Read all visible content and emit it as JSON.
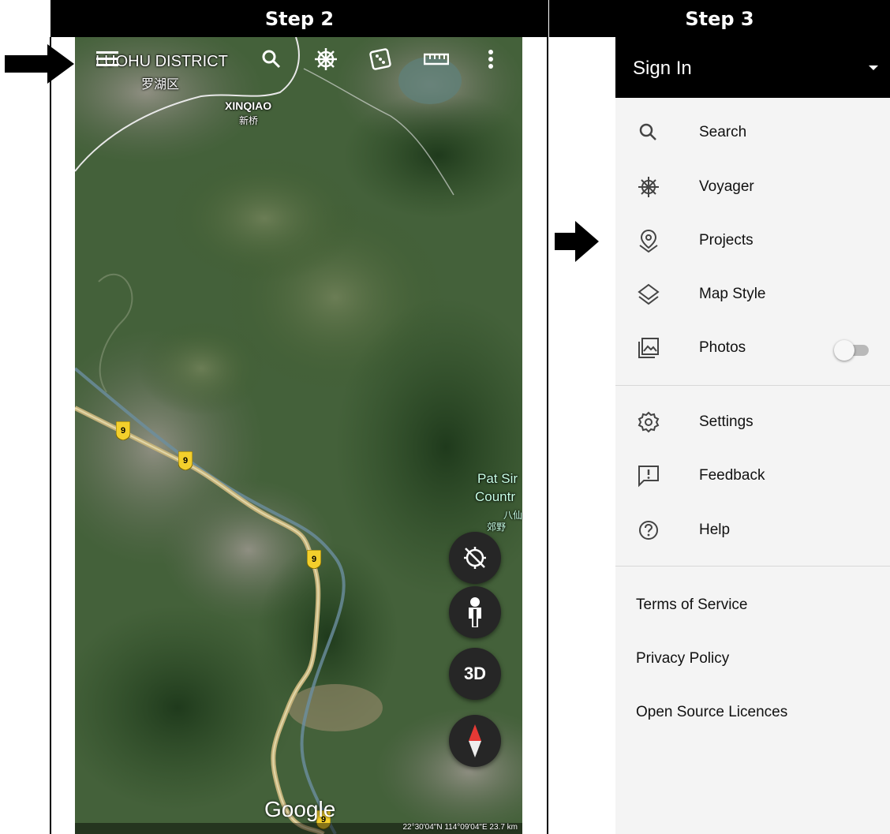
{
  "steps": {
    "step2_label": "Step 2",
    "step3_label": "Step 3"
  },
  "map": {
    "district_label": "LUOHU DISTRICT",
    "district_label_cn": "罗湖区",
    "xinqiao_label": "XINQIAO",
    "xinqiao_label_cn": "新桥",
    "park_label_line1": "Pat Sir",
    "park_label_line2": "Countr",
    "park_label_cn1": "八仙",
    "park_label_cn2": "郊野",
    "route_number": "9",
    "brand_label": "Google",
    "coords_text": "22°30'04\"N 114°09'04\"E 23.7 km",
    "fab_3d_label": "3D",
    "toolbar_icons": [
      "menu-icon",
      "search-icon",
      "voyager-icon",
      "dice-icon",
      "ruler-icon",
      "more-vert-icon"
    ],
    "fab_icons": [
      "compass-off-icon",
      "pegman-icon",
      "3d-button",
      "compass-needle-icon"
    ]
  },
  "menu": {
    "signin_label": "Sign In",
    "items": [
      {
        "label": "Search",
        "icon": "search-icon"
      },
      {
        "label": "Voyager",
        "icon": "voyager-icon"
      },
      {
        "label": "Projects",
        "icon": "projects-icon"
      },
      {
        "label": "Map Style",
        "icon": "layers-icon"
      },
      {
        "label": "Photos",
        "icon": "photos-icon"
      }
    ],
    "items2": [
      {
        "label": "Settings",
        "icon": "gear-icon"
      },
      {
        "label": "Feedback",
        "icon": "feedback-icon"
      },
      {
        "label": "Help",
        "icon": "help-icon"
      }
    ],
    "links": [
      "Terms of Service",
      "Privacy Policy",
      "Open Source Licences"
    ],
    "photos_toggle_on": false
  },
  "colors": {
    "header_bg": "#000000",
    "menu_bg": "#f4f4f4",
    "route_badge": "#f3cf2c"
  }
}
